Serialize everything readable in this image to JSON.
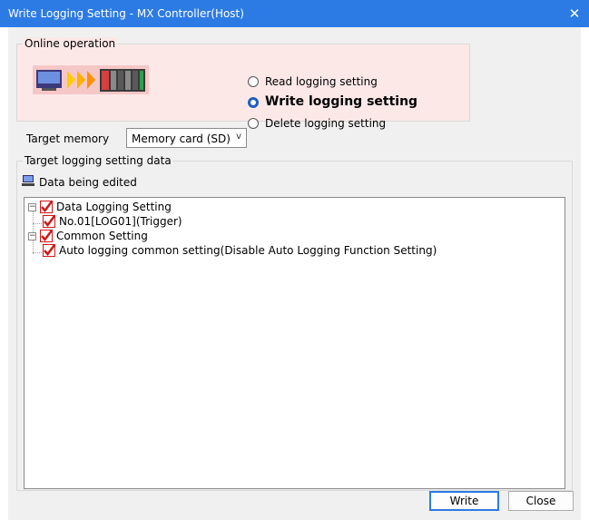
{
  "window": {
    "title": "Write Logging Setting - MX Controller(Host)",
    "close_glyph": "✕"
  },
  "online_operation": {
    "legend": "Online operation",
    "options": [
      {
        "label": "Read logging setting",
        "selected": false
      },
      {
        "label": "Write logging setting",
        "selected": true
      },
      {
        "label": "Delete logging setting",
        "selected": false
      }
    ]
  },
  "target_memory": {
    "label": "Target memory",
    "value": "Memory card (SD)",
    "arrow": "v"
  },
  "target_data": {
    "legend": "Target logging setting data",
    "edit_label": "Data being edited",
    "tree": [
      {
        "label": "Data Logging Setting",
        "level": 0,
        "checked": true,
        "expanded": true
      },
      {
        "label": "No.01[LOG01](Trigger)",
        "level": 1,
        "checked": true
      },
      {
        "label": "Common Setting",
        "level": 0,
        "checked": true,
        "expanded": true
      },
      {
        "label": "Auto logging common setting(Disable Auto Logging Function Setting)",
        "level": 1,
        "checked": true
      }
    ]
  },
  "buttons": {
    "write": "Write",
    "close": "Close"
  },
  "colors": {
    "accent": "#2c7be5",
    "check": "#cc1a1a",
    "online_bg": "#fde8e8"
  },
  "icons": {
    "close": "close-icon",
    "plc": "plc-write-diagram-icon",
    "edit": "computer-icon",
    "check": "checkmark-icon"
  }
}
